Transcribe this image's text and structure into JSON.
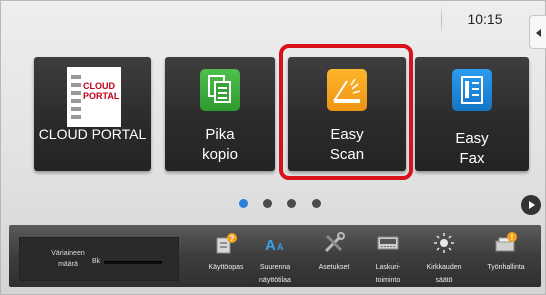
{
  "status": {
    "time": "10:15"
  },
  "tiles": [
    {
      "label": "CLOUD PORTAL",
      "logo_lines": [
        "CLOUD",
        "PORTAL"
      ]
    },
    {
      "label_lines": [
        "Pika",
        "kopio"
      ]
    },
    {
      "label_lines": [
        "Easy",
        "Scan"
      ],
      "highlighted": true
    },
    {
      "label_lines": [
        "Easy",
        "Fax"
      ]
    }
  ],
  "pager": {
    "pages": 4,
    "current": 1
  },
  "toner": {
    "title_lines": [
      "Väriaineen",
      "määrä"
    ],
    "color_label": "Bk",
    "level": 1.0
  },
  "shortcuts": [
    {
      "icon": "manual-icon",
      "label_lines": [
        "Käyttöopas"
      ]
    },
    {
      "icon": "enlarge-display-icon",
      "label_lines": [
        "Suurenna",
        "näyttötilaa"
      ]
    },
    {
      "icon": "settings-tools-icon",
      "label_lines": [
        "Asetukset"
      ]
    },
    {
      "icon": "calculator-icon",
      "label_lines": [
        "Laskuri-",
        "toiminto"
      ]
    },
    {
      "icon": "brightness-icon",
      "label_lines": [
        "Kirkkauden",
        "säätö"
      ]
    },
    {
      "icon": "job-status-icon",
      "label_lines": [
        "Työnhallinta"
      ]
    }
  ],
  "colors": {
    "highlight": "#d6121d",
    "active_page": "#2b7fd6",
    "pika_icon": "#3aa13a",
    "scan_icon": "#f4a118",
    "fax_icon": "#1b86d8",
    "cloud_red": "#c0001c"
  }
}
